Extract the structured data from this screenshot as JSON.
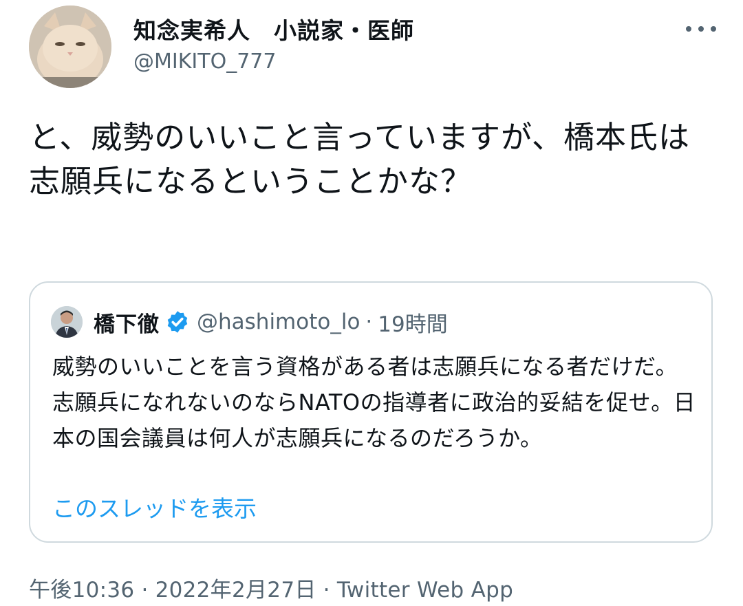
{
  "tweet": {
    "author": {
      "display_name": "知念実希人　小説家・医師",
      "handle": "@MIKITO_777"
    },
    "text": "と、威勢のいいこと言っていますが、橋本氏は志願兵になるということかな？",
    "timestamp": "午後10:36",
    "separator": "·",
    "date": "2022年2月27日",
    "source": "Twitter Web App"
  },
  "quote": {
    "author_name": "橋下徹",
    "handle": "@hashimoto_lo",
    "separator": "·",
    "time": "19時間",
    "text": "威勢のいいことを言う資格がある者は志願兵になる者だけだ。志願兵になれないのならNATOの指導者に政治的妥結を促せ。日本の国会議員は何人が志願兵になるのだろうか。",
    "thread_link": "このスレッドを表示"
  },
  "colors": {
    "text": "#0f1419",
    "secondary": "#536471",
    "link": "#1d9bf0",
    "border": "#cfd9de",
    "verified": "#1d9bf0"
  },
  "icons": {
    "more": "more-horizontal-icon",
    "verified": "verified-badge-icon"
  }
}
